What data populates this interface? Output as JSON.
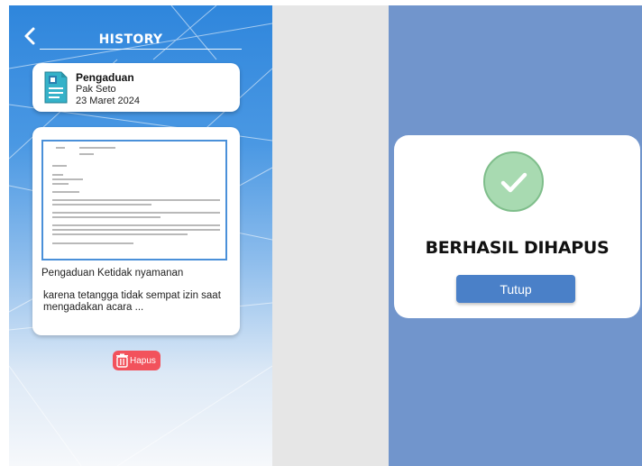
{
  "header": {
    "title": "HISTORY"
  },
  "summary": {
    "title": "Pengaduan",
    "name": "Pak Seto",
    "date": "23 Maret 2024"
  },
  "detail": {
    "line1": "Pengaduan Ketidak nyamanan",
    "line2": "karena tetangga tidak sempat izin saat mengadakan acara ..."
  },
  "actions": {
    "delete_label": "Hapus"
  },
  "modal": {
    "title": "BERHASIL DIHAPUS",
    "close_label": "Tutup"
  },
  "colors": {
    "primary": "#2f86dc",
    "danger": "#f2525c",
    "overlay": "#7195cc",
    "success": "#a8dab1",
    "button": "#4a80c8"
  },
  "icons": [
    "chevron-left-icon",
    "document-icon",
    "trash-icon",
    "checkmark-icon"
  ]
}
